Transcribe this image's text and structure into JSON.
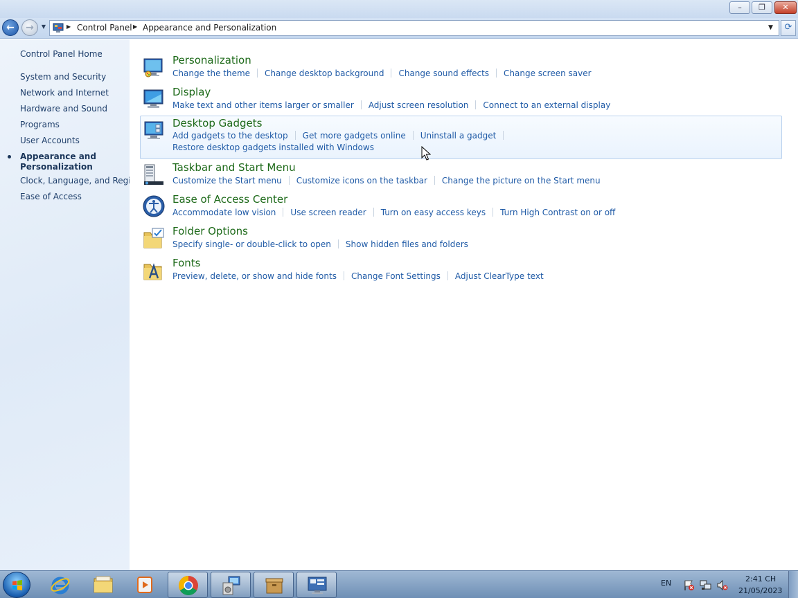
{
  "window": {
    "minimize_glyph": "–",
    "maximize_glyph": "❐",
    "close_glyph": "✕"
  },
  "nav": {
    "back_glyph": "←",
    "forward_glyph": "→",
    "recent_glyph": "▼",
    "dropdown_glyph": "▼",
    "refresh_glyph": "⟳",
    "breadcrumb": [
      "Control Panel",
      "Appearance and Personalization"
    ]
  },
  "left_nav": {
    "home": "Control Panel Home",
    "items": [
      "System and Security",
      "Network and Internet",
      "Hardware and Sound",
      "Programs",
      "User Accounts",
      "Appearance and Personalization",
      "Clock, Language, and Region",
      "Ease of Access"
    ],
    "current": "Appearance and Personalization"
  },
  "categories": [
    {
      "title": "Personalization",
      "links": [
        "Change the theme",
        "Change desktop background",
        "Change sound effects",
        "Change screen saver"
      ]
    },
    {
      "title": "Display",
      "links": [
        "Make text and other items larger or smaller",
        "Adjust screen resolution",
        "Connect to an external display"
      ]
    },
    {
      "title": "Desktop Gadgets",
      "links": [
        "Add gadgets to the desktop",
        "Get more gadgets online",
        "Uninstall a gadget"
      ],
      "second_line": "Restore desktop gadgets installed with Windows"
    },
    {
      "title": "Taskbar and Start Menu",
      "links": [
        "Customize the Start menu",
        "Customize icons on the taskbar",
        "Change the picture on the Start menu"
      ]
    },
    {
      "title": "Ease of Access Center",
      "links": [
        "Accommodate low vision",
        "Use screen reader",
        "Turn on easy access keys",
        "Turn High Contrast on or off"
      ]
    },
    {
      "title": "Folder Options",
      "links": [
        "Specify single- or double-click to open",
        "Show hidden files and folders"
      ]
    },
    {
      "title": "Fonts",
      "links": [
        "Preview, delete, or show and hide fonts",
        "Change Font Settings",
        "Adjust ClearType text"
      ]
    }
  ],
  "taskbar": {
    "language": "EN",
    "time": "2:41 CH",
    "date": "21/05/2023"
  },
  "colors": {
    "link": "#1f5aa6",
    "category_title": "#1e6a1a",
    "left_link": "#1e3e6a"
  }
}
